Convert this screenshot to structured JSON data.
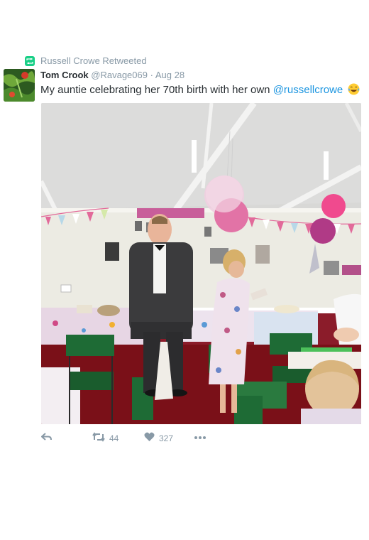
{
  "retweet": {
    "label": "Russell Crowe Retweeted"
  },
  "tweet": {
    "author_name": "Tom Crook",
    "author_handle": "@Ravage069",
    "separator": "·",
    "date": "Aug 28",
    "text_before": "My auntie celebrating her 70th birth with her own",
    "mention": "@russellcrowe"
  },
  "actions": {
    "retweet_count": "44",
    "like_count": "327"
  },
  "colors": {
    "accent": "#1b95e0",
    "retweet_green": "#19cf86",
    "muted": "#8899a6"
  },
  "icons": [
    "retweet-icon",
    "reply-icon",
    "heart-icon",
    "more-icon",
    "emoji-tears-of-joy-icon"
  ]
}
